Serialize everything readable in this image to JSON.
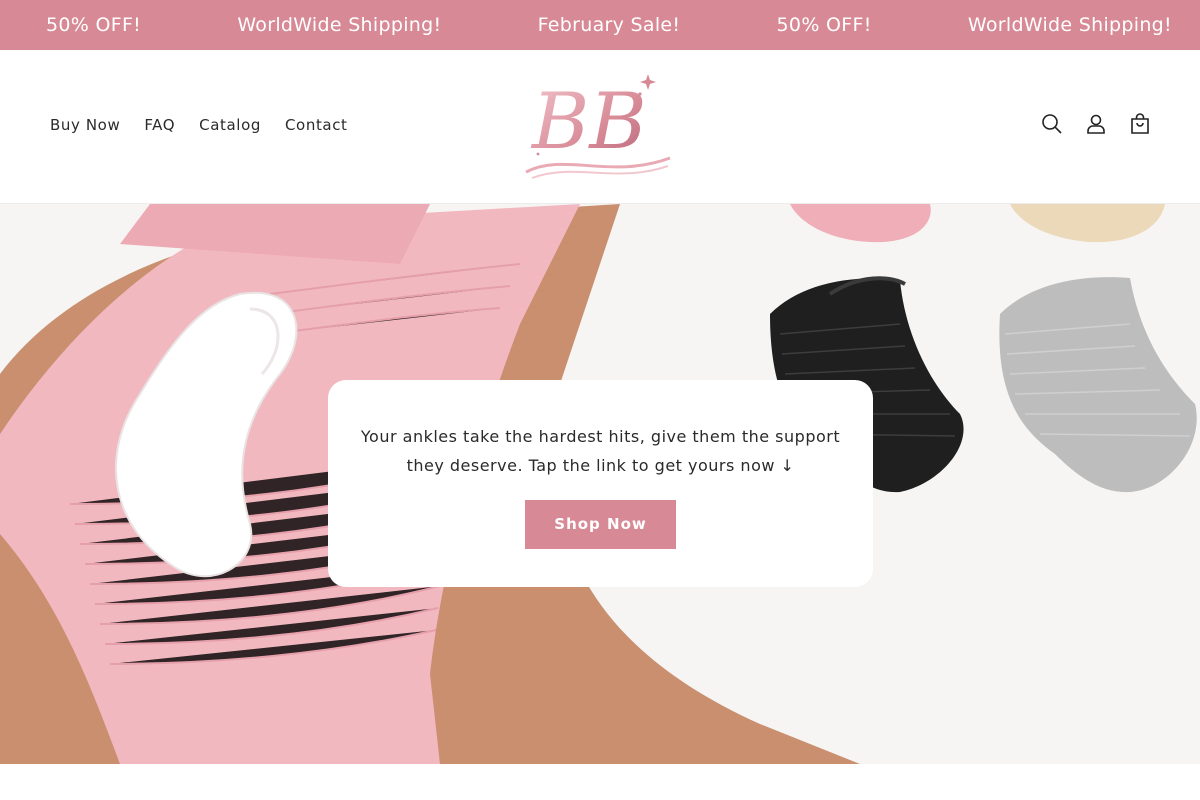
{
  "announcement": {
    "items": [
      "50% OFF!",
      "WorldWide Shipping!",
      "February Sale!",
      "50% OFF!",
      "WorldWide Shipping!"
    ]
  },
  "nav": {
    "items": [
      "Buy Now",
      "FAQ",
      "Catalog",
      "Contact"
    ]
  },
  "logo": {
    "text": "BB"
  },
  "header_icons": [
    "search-icon",
    "account-icon",
    "cart-icon"
  ],
  "hero": {
    "message": "Your ankles take the hardest hits, give them the support they deserve. Tap the link to get yours now ↓",
    "cta_label": "Shop Now"
  },
  "colors": {
    "accent": "#d78a96",
    "brace_pink": "#f2b8c0",
    "skin": "#c98f6e"
  }
}
